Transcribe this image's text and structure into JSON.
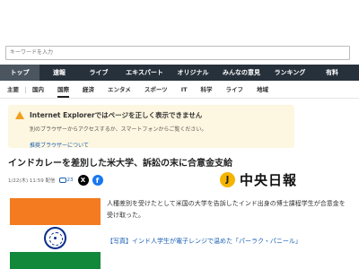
{
  "search": {
    "placeholder": "キーワードを入力"
  },
  "main_nav": {
    "items": [
      {
        "label": "トップ",
        "active": true
      },
      {
        "label": "速報"
      },
      {
        "label": "ライブ"
      },
      {
        "label": "エキスパート"
      },
      {
        "label": "オリジナル"
      },
      {
        "label": "みんなの意見"
      },
      {
        "label": "ランキング"
      },
      {
        "label": "有料"
      }
    ]
  },
  "sub_nav": {
    "items": [
      {
        "label": "主要"
      },
      {
        "label": "国内"
      },
      {
        "label": "国際",
        "active": true
      },
      {
        "label": "経済"
      },
      {
        "label": "エンタメ"
      },
      {
        "label": "スポーツ"
      },
      {
        "label": "IT"
      },
      {
        "label": "科学"
      },
      {
        "label": "ライフ"
      },
      {
        "label": "地域"
      }
    ]
  },
  "notice": {
    "title": "Internet Explorerではページを正しく表示できません",
    "body": "別のブラウザーからアクセスするか、スマートフォンからご覧ください。",
    "link": "推奨ブラウザーについて"
  },
  "article": {
    "title": "インドカレーを差別した米大学、訴訟の末に合意金支給",
    "timestamp": "1/22(木) 11:59 配信",
    "comments": "23",
    "publisher": {
      "logo_text": "J",
      "name": "中央日報"
    },
    "lead": "人種差別を受けたとして米国の大学を告訴したインド出身の博士課程学生が合意金を受け取った。",
    "photo_link": "【写真】インド人学生が電子レンジで温めた「パーラク・パニール」"
  },
  "colors": {
    "nav_bg": "#27313c",
    "notice_bg": "#fdf6e0",
    "link": "#1a5fb4",
    "flag_saffron": "#f47b20",
    "flag_green": "#12883a"
  }
}
